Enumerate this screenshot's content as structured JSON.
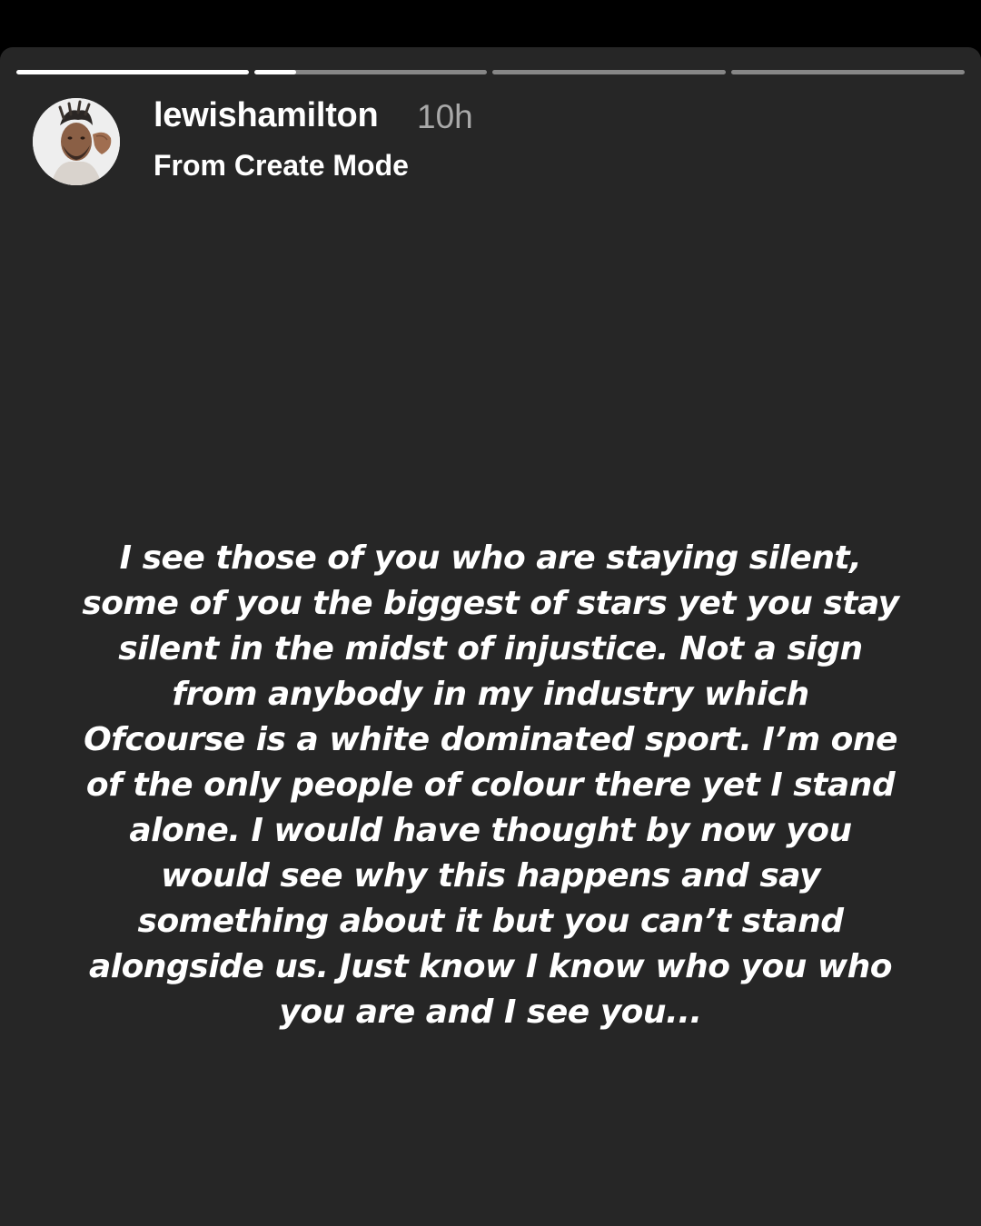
{
  "story": {
    "username": "lewishamilton",
    "time_ago": "10h",
    "subtitle": "From Create Mode",
    "progress": {
      "segment_count": 4,
      "current_segment": 2,
      "current_segment_progress": 0.18
    },
    "text_lines": [
      "I see those of you who are staying silent,",
      "some of you the biggest of stars yet you stay",
      "silent in the midst of injustice. Not a sign",
      "from anybody in my industry which",
      "Ofcourse is a white dominated sport. I’m one",
      "of the only people of colour there yet I stand",
      "alone. I would have thought by now you",
      "would see why this happens and say",
      "something about it but you can’t stand",
      "alongside us. Just know I know who you who",
      "you are and I see you..."
    ],
    "colors": {
      "background": "#262626",
      "text": "#ffffff",
      "timestamp": "#a9a9a9",
      "progress_track": "rgba(255,255,255,0.45)",
      "progress_fill": "#ffffff"
    }
  }
}
